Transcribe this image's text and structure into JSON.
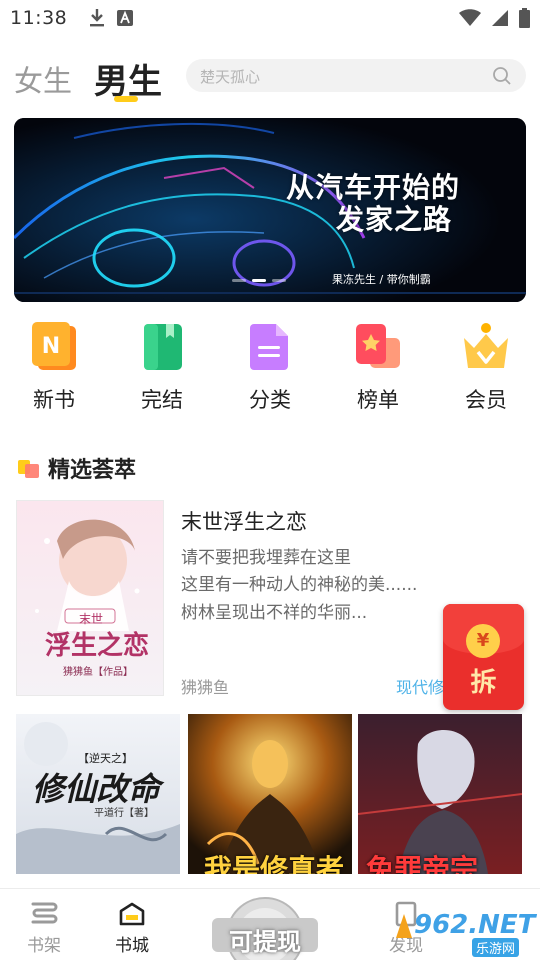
{
  "status_bar": {
    "time": "11:38"
  },
  "tabs": {
    "girl": "女生",
    "boy": "男生"
  },
  "search": {
    "placeholder": "楚天孤心"
  },
  "banner": {
    "line1": "从汽车开始的",
    "line2": "发家之路",
    "credit": "果冻先生 / 带你制霸"
  },
  "categories": [
    {
      "label": "新书",
      "icon": "new-book-icon"
    },
    {
      "label": "完结",
      "icon": "finished-book-icon"
    },
    {
      "label": "分类",
      "icon": "category-icon"
    },
    {
      "label": "榜单",
      "icon": "ranking-icon"
    },
    {
      "label": "会员",
      "icon": "crown-icon"
    }
  ],
  "section": {
    "title": "精选荟萃"
  },
  "featured": {
    "title": "末世浮生之恋",
    "desc_lines": [
      "请不要把我埋葬在这里",
      "这里有一种动人的神秘的美......",
      "树林呈现出不祥的华丽..."
    ],
    "author": "狒狒鱼",
    "genre": "现代修",
    "cover_text": {
      "small": "末世",
      "big": "浮生之恋",
      "author": "狒狒鱼【作品】"
    }
  },
  "red_packet": {
    "coin": "¥",
    "label": "拆"
  },
  "covers": [
    {
      "text": "修仙改命",
      "sub": "【逆天之】",
      "author": "平道行【著】"
    },
    {
      "text": "我是修真者"
    },
    {
      "text": "免罪帝宗"
    }
  ],
  "bottom_nav": {
    "shelf": "书架",
    "store": "书城",
    "discover": "发现",
    "withdraw": "可提现"
  },
  "watermark": {
    "text": "962.NET",
    "sub": "乐游网"
  },
  "colors": {
    "accent": "#ffcc1a",
    "genre": "#4fb3e8",
    "red_packet": "#ea2f2c"
  }
}
